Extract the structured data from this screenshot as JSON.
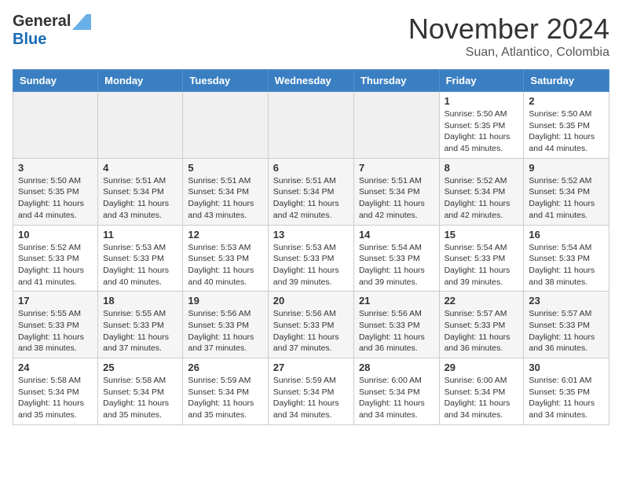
{
  "header": {
    "logo": {
      "general": "General",
      "blue": "Blue"
    },
    "title": "November 2024",
    "subtitle": "Suan, Atlantico, Colombia"
  },
  "days_of_week": [
    "Sunday",
    "Monday",
    "Tuesday",
    "Wednesday",
    "Thursday",
    "Friday",
    "Saturday"
  ],
  "weeks": [
    [
      {
        "day": "",
        "info": ""
      },
      {
        "day": "",
        "info": ""
      },
      {
        "day": "",
        "info": ""
      },
      {
        "day": "",
        "info": ""
      },
      {
        "day": "",
        "info": ""
      },
      {
        "day": "1",
        "info": "Sunrise: 5:50 AM\nSunset: 5:35 PM\nDaylight: 11 hours\nand 45 minutes."
      },
      {
        "day": "2",
        "info": "Sunrise: 5:50 AM\nSunset: 5:35 PM\nDaylight: 11 hours\nand 44 minutes."
      }
    ],
    [
      {
        "day": "3",
        "info": "Sunrise: 5:50 AM\nSunset: 5:35 PM\nDaylight: 11 hours\nand 44 minutes."
      },
      {
        "day": "4",
        "info": "Sunrise: 5:51 AM\nSunset: 5:34 PM\nDaylight: 11 hours\nand 43 minutes."
      },
      {
        "day": "5",
        "info": "Sunrise: 5:51 AM\nSunset: 5:34 PM\nDaylight: 11 hours\nand 43 minutes."
      },
      {
        "day": "6",
        "info": "Sunrise: 5:51 AM\nSunset: 5:34 PM\nDaylight: 11 hours\nand 42 minutes."
      },
      {
        "day": "7",
        "info": "Sunrise: 5:51 AM\nSunset: 5:34 PM\nDaylight: 11 hours\nand 42 minutes."
      },
      {
        "day": "8",
        "info": "Sunrise: 5:52 AM\nSunset: 5:34 PM\nDaylight: 11 hours\nand 42 minutes."
      },
      {
        "day": "9",
        "info": "Sunrise: 5:52 AM\nSunset: 5:34 PM\nDaylight: 11 hours\nand 41 minutes."
      }
    ],
    [
      {
        "day": "10",
        "info": "Sunrise: 5:52 AM\nSunset: 5:33 PM\nDaylight: 11 hours\nand 41 minutes."
      },
      {
        "day": "11",
        "info": "Sunrise: 5:53 AM\nSunset: 5:33 PM\nDaylight: 11 hours\nand 40 minutes."
      },
      {
        "day": "12",
        "info": "Sunrise: 5:53 AM\nSunset: 5:33 PM\nDaylight: 11 hours\nand 40 minutes."
      },
      {
        "day": "13",
        "info": "Sunrise: 5:53 AM\nSunset: 5:33 PM\nDaylight: 11 hours\nand 39 minutes."
      },
      {
        "day": "14",
        "info": "Sunrise: 5:54 AM\nSunset: 5:33 PM\nDaylight: 11 hours\nand 39 minutes."
      },
      {
        "day": "15",
        "info": "Sunrise: 5:54 AM\nSunset: 5:33 PM\nDaylight: 11 hours\nand 39 minutes."
      },
      {
        "day": "16",
        "info": "Sunrise: 5:54 AM\nSunset: 5:33 PM\nDaylight: 11 hours\nand 38 minutes."
      }
    ],
    [
      {
        "day": "17",
        "info": "Sunrise: 5:55 AM\nSunset: 5:33 PM\nDaylight: 11 hours\nand 38 minutes."
      },
      {
        "day": "18",
        "info": "Sunrise: 5:55 AM\nSunset: 5:33 PM\nDaylight: 11 hours\nand 37 minutes."
      },
      {
        "day": "19",
        "info": "Sunrise: 5:56 AM\nSunset: 5:33 PM\nDaylight: 11 hours\nand 37 minutes."
      },
      {
        "day": "20",
        "info": "Sunrise: 5:56 AM\nSunset: 5:33 PM\nDaylight: 11 hours\nand 37 minutes."
      },
      {
        "day": "21",
        "info": "Sunrise: 5:56 AM\nSunset: 5:33 PM\nDaylight: 11 hours\nand 36 minutes."
      },
      {
        "day": "22",
        "info": "Sunrise: 5:57 AM\nSunset: 5:33 PM\nDaylight: 11 hours\nand 36 minutes."
      },
      {
        "day": "23",
        "info": "Sunrise: 5:57 AM\nSunset: 5:33 PM\nDaylight: 11 hours\nand 36 minutes."
      }
    ],
    [
      {
        "day": "24",
        "info": "Sunrise: 5:58 AM\nSunset: 5:34 PM\nDaylight: 11 hours\nand 35 minutes."
      },
      {
        "day": "25",
        "info": "Sunrise: 5:58 AM\nSunset: 5:34 PM\nDaylight: 11 hours\nand 35 minutes."
      },
      {
        "day": "26",
        "info": "Sunrise: 5:59 AM\nSunset: 5:34 PM\nDaylight: 11 hours\nand 35 minutes."
      },
      {
        "day": "27",
        "info": "Sunrise: 5:59 AM\nSunset: 5:34 PM\nDaylight: 11 hours\nand 34 minutes."
      },
      {
        "day": "28",
        "info": "Sunrise: 6:00 AM\nSunset: 5:34 PM\nDaylight: 11 hours\nand 34 minutes."
      },
      {
        "day": "29",
        "info": "Sunrise: 6:00 AM\nSunset: 5:34 PM\nDaylight: 11 hours\nand 34 minutes."
      },
      {
        "day": "30",
        "info": "Sunrise: 6:01 AM\nSunset: 5:35 PM\nDaylight: 11 hours\nand 34 minutes."
      }
    ]
  ]
}
